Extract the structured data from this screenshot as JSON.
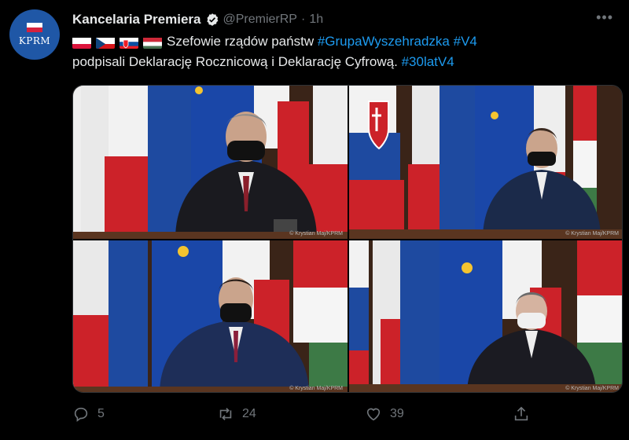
{
  "account": {
    "avatar_text": "KPRM",
    "display_name": "Kancelaria Premiera",
    "handle": "@PremierRP",
    "separator": "·",
    "time": "1h"
  },
  "tweet": {
    "flags": [
      "poland-flag",
      "czech-flag",
      "slovakia-flag",
      "hungary-flag"
    ],
    "text_part1": "Szefowie rządów państw",
    "hashtag1": "#GrupaWyszehradzka",
    "hashtag2": "#V4",
    "text_part2": "podpisali Deklarację Rocznicową i Deklarację Cyfrową.",
    "hashtag3": "#30latV4"
  },
  "media": {
    "credit": "© Krystian Maj/KPRM"
  },
  "actions": {
    "reply_count": "5",
    "retweet_count": "24",
    "like_count": "39"
  },
  "colors": {
    "background": "#000000",
    "text": "#e7e9ea",
    "muted": "#71767b",
    "link": "#1d9bf0",
    "verified": "#1d9bf0"
  }
}
